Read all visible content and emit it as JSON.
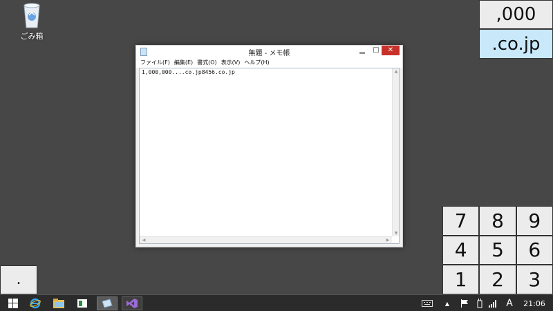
{
  "desktop": {
    "recycle_bin_label": "ごみ箱"
  },
  "notepad": {
    "title": "無題 - メモ帳",
    "menu": [
      "ファイル(F)",
      "編集(E)",
      "書式(O)",
      "表示(V)",
      "ヘルプ(H)"
    ],
    "content": "1,000,000....co.jp8456.co.jp",
    "minimize_glyph": "▁",
    "maximize_glyph": "□",
    "close_glyph": "✕"
  },
  "keys": {
    "triple_zero": ",000",
    "co_jp": ".co.jp",
    "dot": ".",
    "numpad": [
      "7",
      "8",
      "9",
      "4",
      "5",
      "6",
      "1",
      "2",
      "3"
    ]
  },
  "taskbar": {
    "clock": "21:06",
    "ime": "A"
  },
  "icons": {
    "recycle_bin": "recycle-bin-icon",
    "start": "windows-logo-icon",
    "ie": "internet-explorer-icon",
    "explorer": "file-explorer-icon",
    "notepad": "notepad-icon",
    "vs": "visual-studio-icon"
  },
  "colors": {
    "desktop_bg": "#474747",
    "close_button": "#c7312a",
    "highlight_key": "#c9e9fb"
  }
}
